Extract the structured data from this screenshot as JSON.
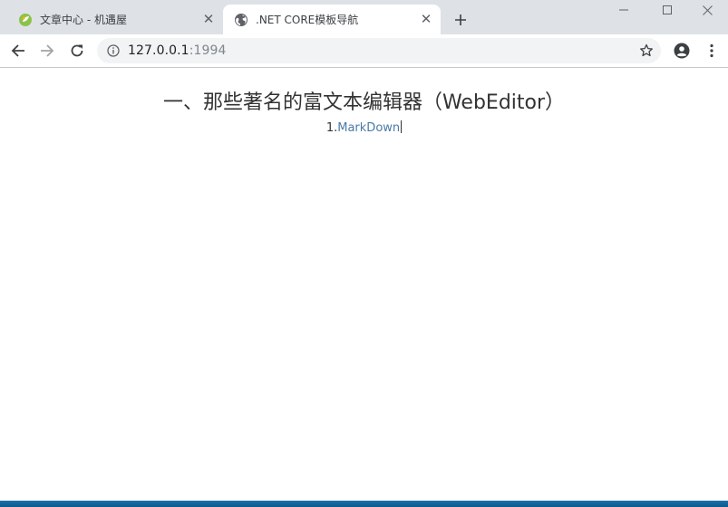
{
  "tabs": [
    {
      "title": "文章中心 - 机遇屋",
      "favicon": "leaf-icon",
      "active": false
    },
    {
      "title": ".NET CORE模板导航",
      "favicon": "globe-icon",
      "active": true
    }
  ],
  "toolbar": {
    "url_host": "127.0.0.1",
    "url_port": ":1994"
  },
  "page": {
    "heading": "一、那些著名的富文本编辑器（WebEditor）",
    "item_number": "1.",
    "item_link": "MarkDown"
  },
  "colors": {
    "tabstrip": "#dee1e6",
    "link": "#4a7aa8",
    "text": "#333333"
  }
}
